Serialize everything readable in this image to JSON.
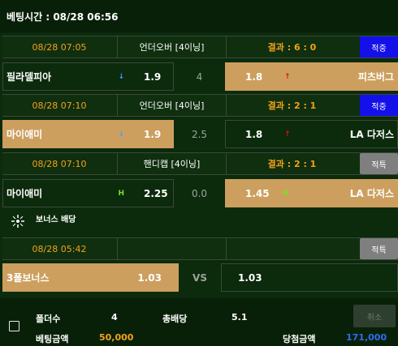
{
  "header": {
    "bet_time": "베팅시간 : 08/28 06:56"
  },
  "games": [
    {
      "date": "08/28 07:05",
      "market": "언더오버 [4이닝]",
      "result": "결과 : 6 : 0",
      "status": "적중",
      "home_team": "필라델피아",
      "home_odds": "1.9",
      "line": "4",
      "away_odds": "1.8",
      "away_team": "피츠버그",
      "home_selected": false,
      "away_selected": true,
      "home_marker": "↓",
      "away_marker": "↑"
    },
    {
      "date": "08/28 07:10",
      "market": "언더오버 [4이닝]",
      "result": "결과 : 2 : 1",
      "status": "적중",
      "home_team": "마이애미",
      "home_odds": "1.9",
      "line": "2.5",
      "away_odds": "1.8",
      "away_team": "LA 다저스",
      "home_selected": true,
      "away_selected": false,
      "home_marker": "↓",
      "away_marker": "↑"
    },
    {
      "date": "08/28 07:10",
      "market": "핸디캡 [4이닝]",
      "result": "결과 : 2 : 1",
      "status": "적특",
      "home_team": "마이애미",
      "home_odds": "2.25",
      "line": "0.0",
      "away_odds": "1.45",
      "away_team": "LA 다저스",
      "home_selected": false,
      "away_selected": true,
      "home_marker": "H",
      "away_marker": "H"
    }
  ],
  "bonus": {
    "label": "보너스 배당",
    "date": "08/28 05:42",
    "status": "적특",
    "name": "3폴보너스",
    "odds": "1.03",
    "vs": "VS",
    "right_odds": "1.03"
  },
  "footer": {
    "folders_label": "폴더수",
    "folders_value": "4",
    "total_odds_label": "총배당",
    "total_odds_value": "5.1",
    "cancel_label": "취소",
    "bet_amount_label": "베팅금액",
    "bet_amount_value": "50,000",
    "win_amount_label": "당첨금액",
    "win_amount_value": "171,000"
  },
  "colors": {
    "accent_orange": "#f3a11b",
    "selected_bg": "#cc9f5f",
    "hit_blue": "#1410ea",
    "miss_gray": "#7f7f7f",
    "win_blue": "#2e6df0"
  }
}
